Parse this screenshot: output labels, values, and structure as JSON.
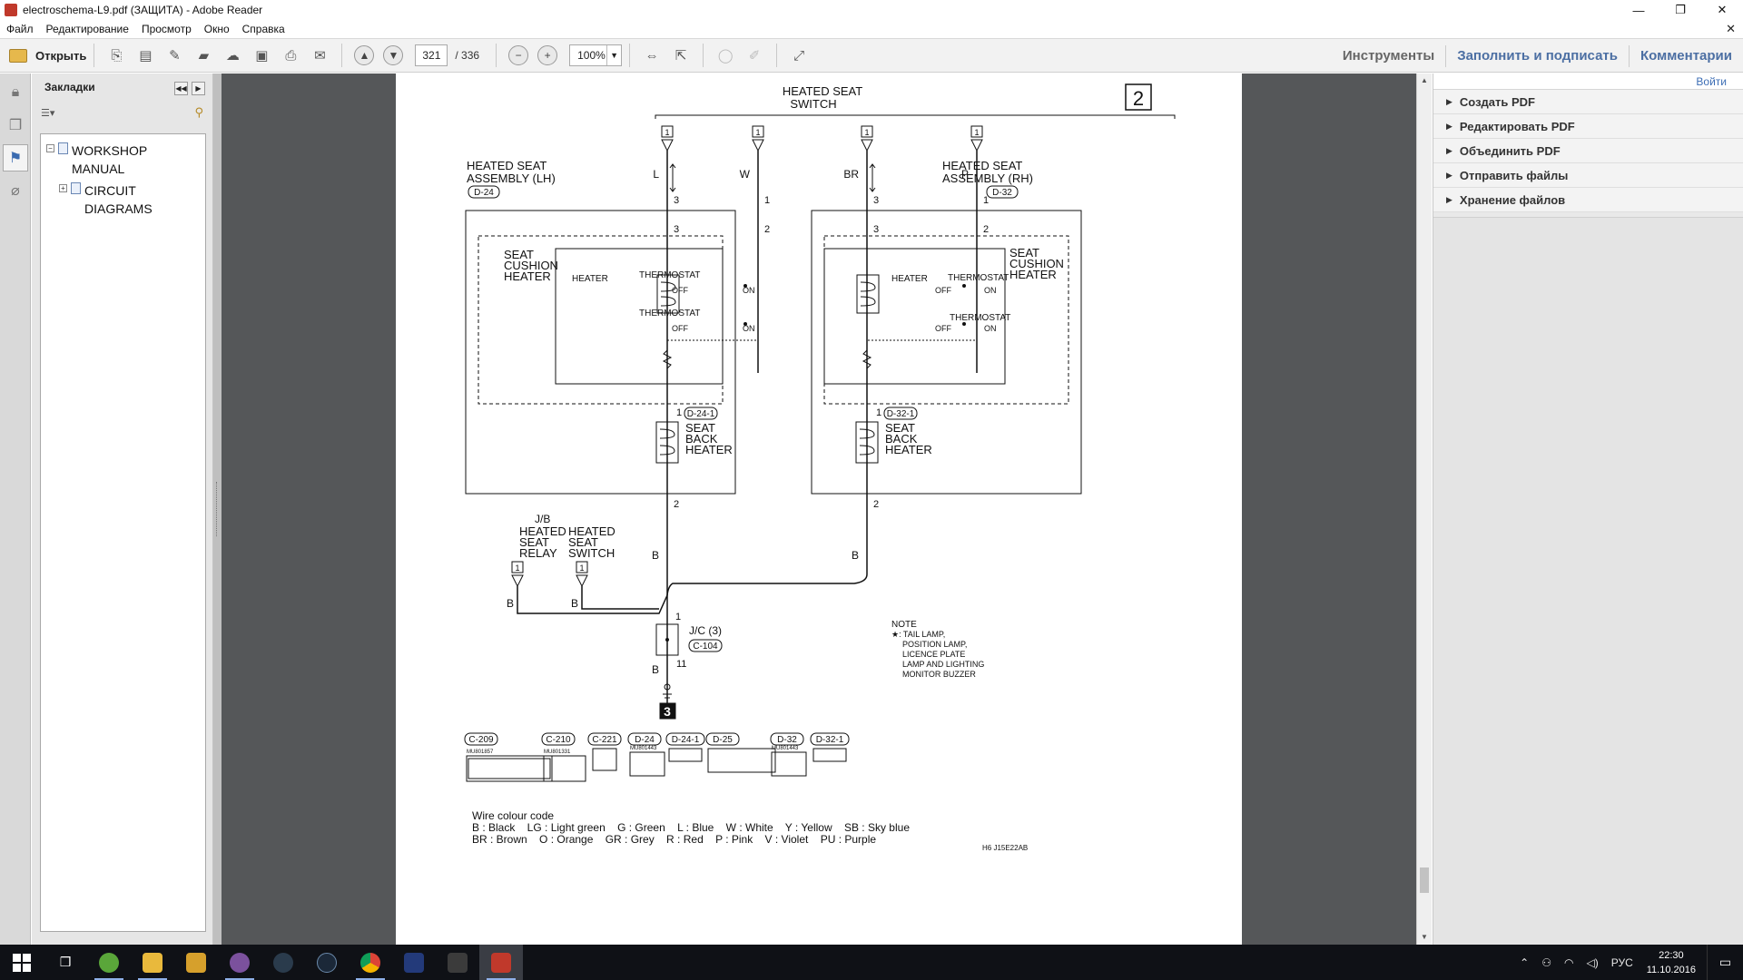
{
  "window": {
    "title": "electroschema-L9.pdf (ЗАЩИТА) - Adobe Reader",
    "minimize": "—",
    "restore": "❐",
    "close": "✕"
  },
  "menu": [
    "Файл",
    "Редактирование",
    "Просмотр",
    "Окно",
    "Справка"
  ],
  "menu_close": "✕",
  "toolbar": {
    "open_label": "Открыть",
    "page_current": "321",
    "page_total": "/ 336",
    "zoom": "100%",
    "tools": "Инструменты",
    "fill_sign": "Заполнить и подписать",
    "comments": "Комментарии"
  },
  "bookmarks": {
    "title": "Закладки",
    "items": [
      {
        "label": "WORKSHOP MANUAL",
        "expander": "−"
      },
      {
        "label": "CIRCUIT DIAGRAMS",
        "expander": "+"
      }
    ]
  },
  "right_panel": {
    "signin": "Войти",
    "items": [
      "Создать PDF",
      "Редактировать PDF",
      "Объединить PDF",
      "Отправить файлы",
      "Хранение файлов"
    ]
  },
  "schematic": {
    "page_badge": "2",
    "switch_title_1": "HEATED SEAT",
    "switch_title_2": "SWITCH",
    "pin1": "1",
    "pin2": "2",
    "pin3": "3",
    "pin11": "11",
    "wires": {
      "L": "L",
      "W": "W",
      "BR": "BR",
      "P": "P",
      "B": "B"
    },
    "lh_title_1": "HEATED SEAT",
    "lh_title_2": "ASSEMBLY (LH)",
    "lh_conn": "D-24",
    "rh_title_1": "HEATED SEAT",
    "rh_title_2": "ASSEMBLY (RH)",
    "rh_conn": "D-32",
    "seat_cushion": [
      "SEAT",
      "CUSHION",
      "HEATER"
    ],
    "heater": "HEATER",
    "thermostat": "THERMOSTAT",
    "off": "OFF",
    "on": "ON",
    "seat_back": [
      "SEAT",
      "BACK",
      "HEATER"
    ],
    "conn_lh_back": "D-24-1",
    "conn_rh_back": "D-32-1",
    "jb": "J/B",
    "relay": [
      "HEATED",
      "SEAT",
      "RELAY"
    ],
    "switch2": [
      "HEATED",
      "SEAT",
      "SWITCH"
    ],
    "jc": "J/C (3)",
    "jc_conn": "C-104",
    "ground": "3",
    "note_title": "NOTE",
    "note_lines": [
      "★: TAIL LAMP,",
      "POSITION LAMP,",
      "LICENCE PLATE",
      "LAMP AND LIGHTING",
      "MONITOR BUZZER"
    ],
    "connectors": [
      "C-209",
      "C-210",
      "C-221",
      "D-24",
      "D-24-1",
      "D-25",
      "D-32",
      "D-32-1"
    ],
    "conn_parts": [
      "MU801857",
      "MU801331",
      "MU801443",
      "MU801443"
    ],
    "wire_code_title": "Wire colour code",
    "wire_code_line1": "B : Black    LG : Light green    G : Green    L : Blue    W : White    Y : Yellow    SB : Sky blue",
    "wire_code_line2": "BR : Brown    O : Orange    GR : Grey    R : Red    P : Pink    V : Violet    PU : Purple",
    "fig_code": "H6 J15E22AB"
  },
  "taskbar": {
    "lang": "РУС",
    "time": "22:30",
    "date": "11.10.2016"
  },
  "colors": {
    "doc_bg": "#555759",
    "accent_link": "#4c6fa3",
    "taskbar": "#0f1116"
  }
}
